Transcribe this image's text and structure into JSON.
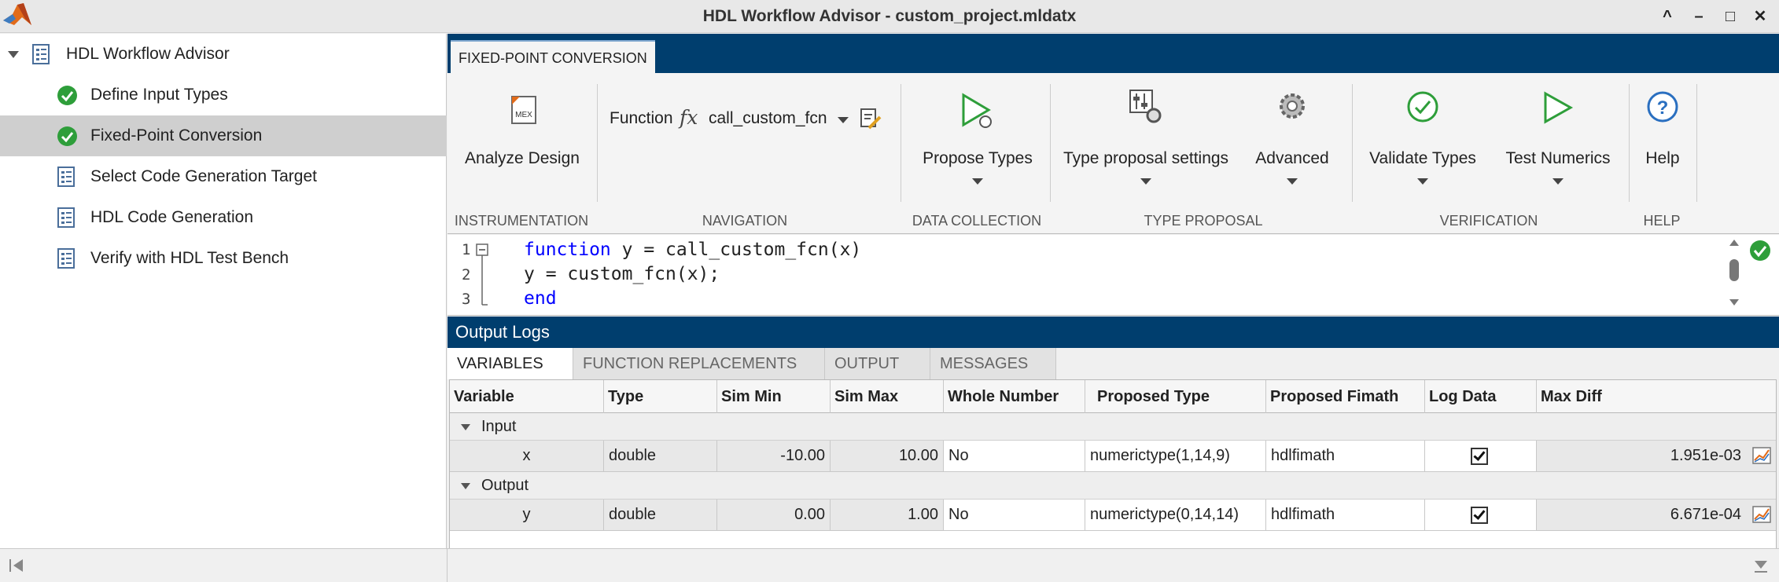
{
  "window": {
    "title": "HDL Workflow Advisor - custom_project.mldatx",
    "minimize_glyph": "^",
    "min_glyph": "–",
    "max_glyph": "□",
    "close_glyph": "✕"
  },
  "sidebar": {
    "root": "HDL Workflow Advisor",
    "items": [
      {
        "label": "Define Input Types",
        "icon": "check-circle-icon"
      },
      {
        "label": "Fixed-Point Conversion",
        "icon": "check-circle-icon"
      },
      {
        "label": "Select Code Generation Target",
        "icon": "task-list-icon"
      },
      {
        "label": "HDL Code Generation",
        "icon": "task-list-icon"
      },
      {
        "label": "Verify with HDL Test Bench",
        "icon": "task-list-icon"
      }
    ]
  },
  "toolstrip": {
    "tab": "FIXED-POINT CONVERSION",
    "analyze_design": "Analyze Design",
    "function_label": "Function",
    "fx_glyph": "fx",
    "function_value": "call_custom_fcn",
    "propose_types": "Propose Types",
    "type_proposal_settings": "Type proposal settings",
    "advanced": "Advanced",
    "validate_types": "Validate Types",
    "test_numerics": "Test Numerics",
    "help": "Help",
    "mex_text": "MEX",
    "sections": {
      "instrumentation": "INSTRUMENTATION",
      "navigation": "NAVIGATION",
      "data_collection": "DATA COLLECTION",
      "type_proposal": "TYPE PROPOSAL",
      "verification": "VERIFICATION",
      "help": "HELP"
    }
  },
  "editor": {
    "lines": [
      {
        "num": "1",
        "kw": "function",
        "rest": " y = call_custom_fcn(x)"
      },
      {
        "num": "2",
        "kw": "",
        "rest": "y = custom_fcn(x);"
      },
      {
        "num": "3",
        "kw": "end",
        "rest": ""
      }
    ]
  },
  "output": {
    "title": "Output Logs",
    "tabs": [
      "VARIABLES",
      "FUNCTION REPLACEMENTS",
      "OUTPUT",
      "MESSAGES"
    ],
    "columns": [
      "Variable",
      "Type",
      "Sim Min",
      "Sim Max",
      "Whole Number",
      "Proposed Type",
      "Proposed Fimath",
      "Log Data",
      "Max Diff"
    ],
    "groups": [
      {
        "name": "Input",
        "row": {
          "variable": "x",
          "type": "double",
          "sim_min": "-10.00",
          "sim_max": "10.00",
          "whole": "No",
          "proposed_type": "numerictype(1,14,9)",
          "fimath": "hdlfimath",
          "log_data": true,
          "max_diff": "1.951e-03"
        }
      },
      {
        "name": "Output",
        "row": {
          "variable": "y",
          "type": "double",
          "sim_min": "0.00",
          "sim_max": "1.00",
          "whole": "No",
          "proposed_type": "numerictype(0,14,14)",
          "fimath": "hdlfimath",
          "log_data": true,
          "max_diff": "6.671e-04"
        }
      }
    ]
  },
  "colors": {
    "accent_blue": "#003e6e",
    "check_green": "#2e9e3a",
    "keyword_blue": "#0000ff"
  }
}
